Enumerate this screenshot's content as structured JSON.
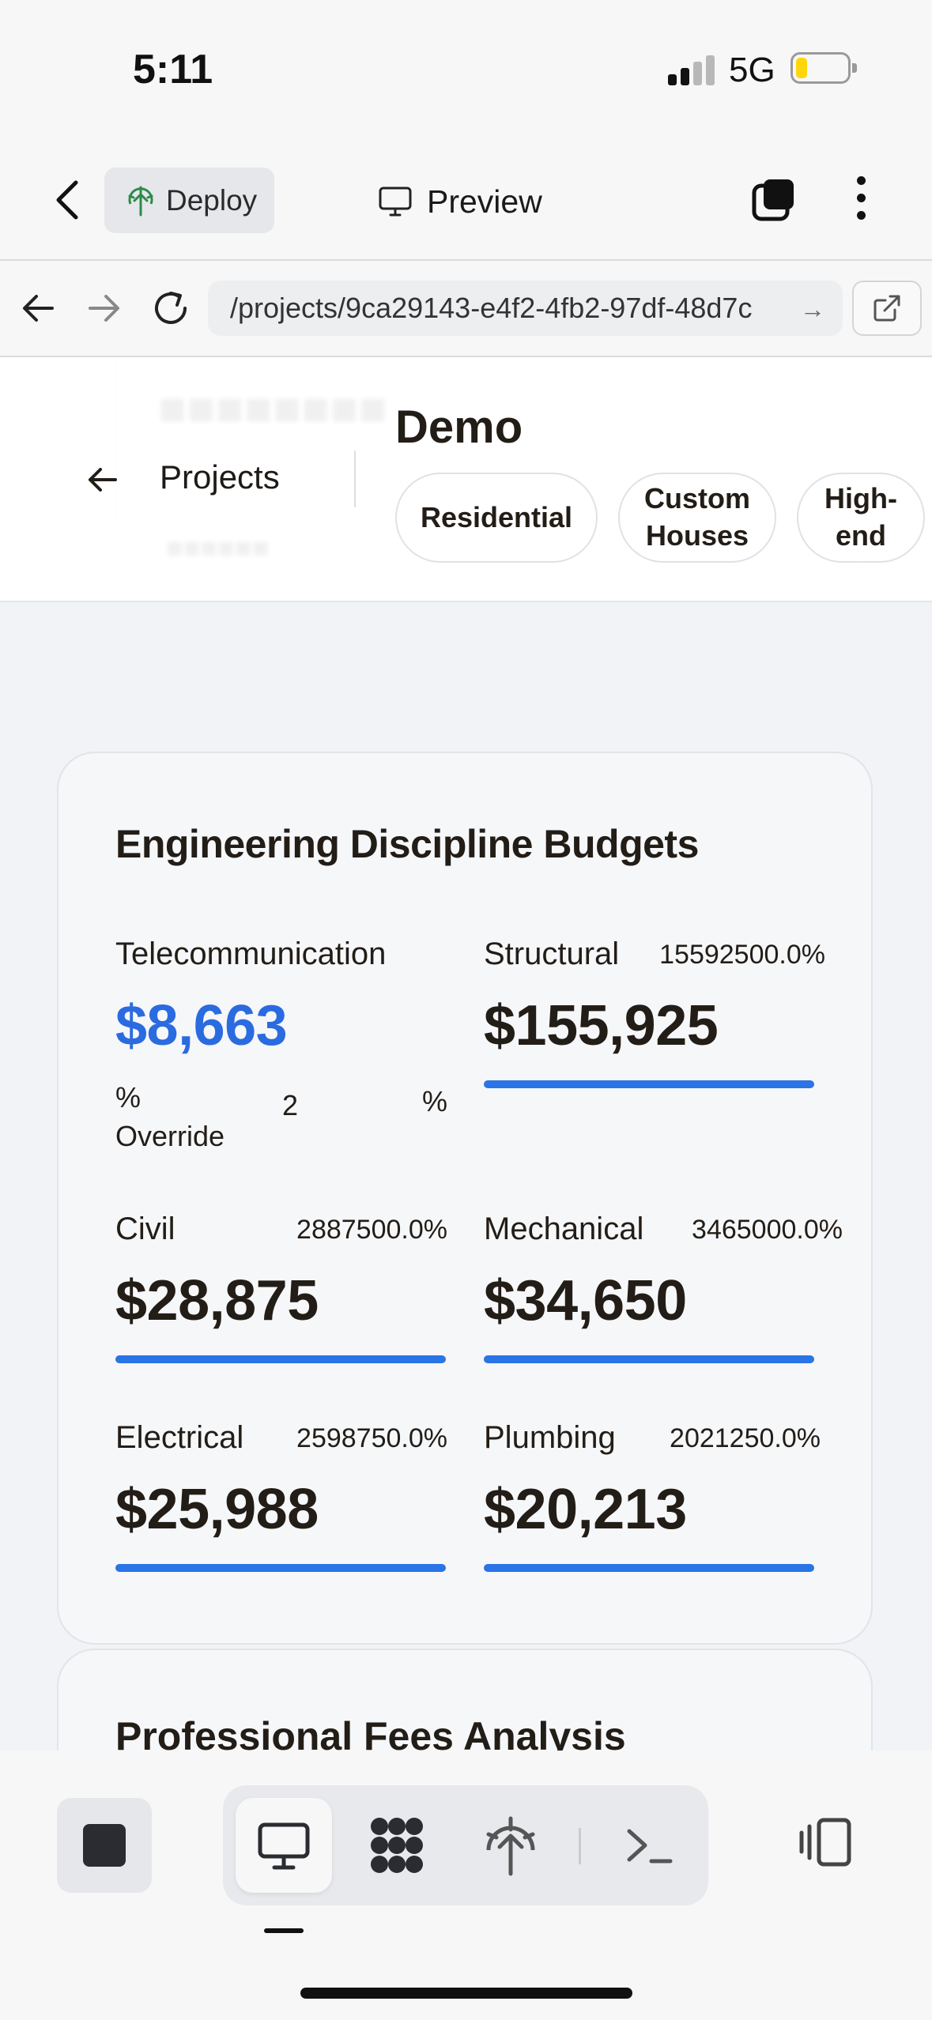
{
  "status_bar": {
    "time": "5:11",
    "network": "5G",
    "battery_color": "#ffd60a"
  },
  "toolbar": {
    "deploy_label": "Deploy",
    "preview_label": "Preview"
  },
  "browser": {
    "url": "/projects/9ca29143-e4f2-4fb2-97df-48d7c"
  },
  "page": {
    "back_label": "Projects",
    "title": "Demo",
    "chips": [
      "Residential",
      "Custom Houses",
      "High-end"
    ]
  },
  "budgets": {
    "title": "Engineering Discipline Budgets",
    "telecom": {
      "name": "Telecommunication",
      "amount": "$8,663",
      "override_label": "% Override",
      "override_value": "2",
      "override_unit": "%"
    },
    "structural": {
      "name": "Structural",
      "pct": "15592500.0%",
      "amount": "$155,925"
    },
    "civil": {
      "name": "Civil",
      "pct": "2887500.0%",
      "amount": "$28,875"
    },
    "mechanical": {
      "name": "Mechanical",
      "pct": "3465000.0%",
      "amount": "$34,650"
    },
    "electrical": {
      "name": "Electrical",
      "pct": "2598750.0%",
      "amount": "$25,988"
    },
    "plumbing": {
      "name": "Plumbing",
      "pct": "2021250.0%",
      "amount": "$20,213"
    }
  },
  "fees": {
    "title": "Professional Fees Analysis"
  },
  "colors": {
    "accent": "#2a74e6",
    "amount_blue": "#2b6be0",
    "text": "#231d17"
  }
}
